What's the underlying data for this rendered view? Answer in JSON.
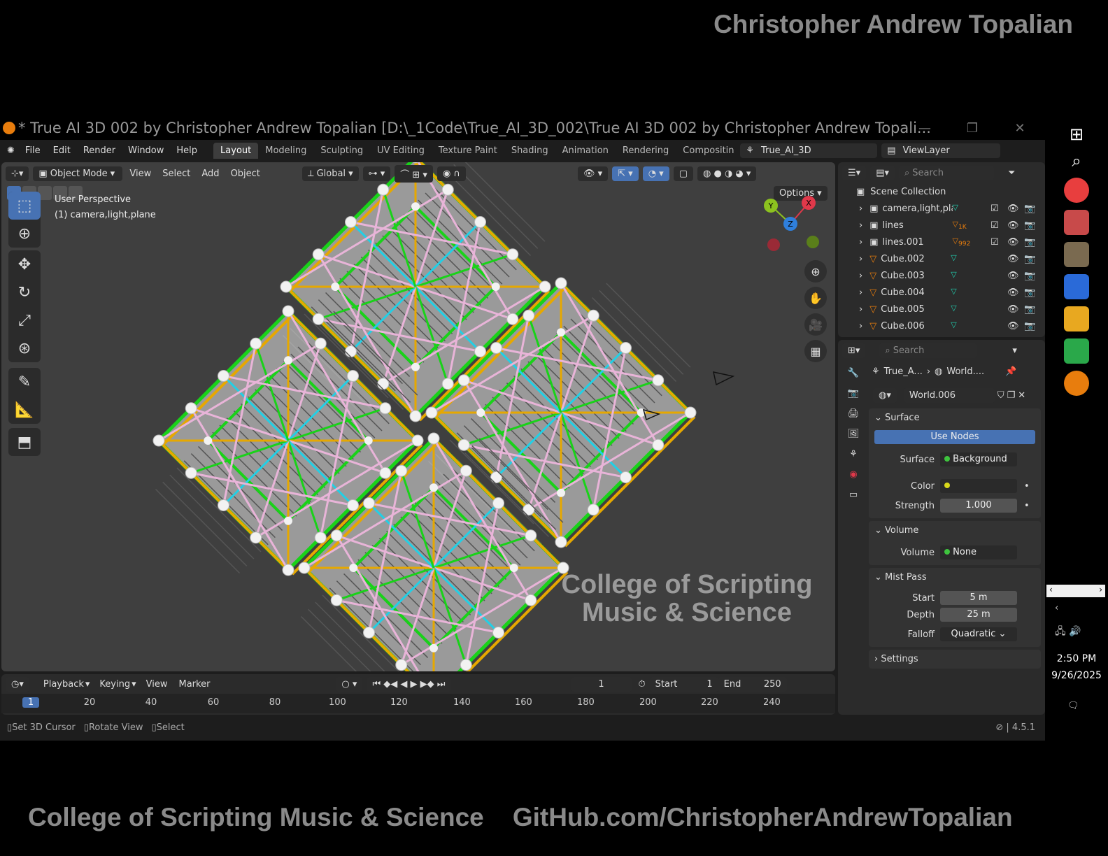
{
  "overlay": {
    "top_name": "Christopher Andrew Topalian",
    "bottom_left": "College of Scripting Music & Science",
    "bottom_right": "GitHub.com/ChristopherAndrewTopalian"
  },
  "window": {
    "title": "* True AI 3D 002 by Christopher Andrew Topalian [D:\\_1Code\\True_AI_3D_002\\True AI 3D 002 by Christopher Andrew Topali...",
    "minimize": "—",
    "restore": "❐",
    "close": "✕"
  },
  "menu": {
    "items": [
      "File",
      "Edit",
      "Render",
      "Window",
      "Help"
    ],
    "workspaces": [
      "Layout",
      "Modeling",
      "Sculpting",
      "UV Editing",
      "Texture Paint",
      "Shading",
      "Animation",
      "Rendering",
      "Compositin"
    ],
    "scene": "True_AI_3D",
    "view_layer": "ViewLayer"
  },
  "viewport": {
    "mode": "Object Mode",
    "menus": [
      "View",
      "Select",
      "Add",
      "Object"
    ],
    "orientation": "Global",
    "options": "Options",
    "persp": "User Perspective",
    "active": "(1) camera,light,plane",
    "watermark1": "College of Scripting",
    "watermark2": "Music & Science",
    "gizmo": {
      "x": "X",
      "y": "Y",
      "z": "Z"
    }
  },
  "timeline": {
    "menus": [
      "Playback",
      "Keying",
      "View",
      "Marker"
    ],
    "current_frame": "1",
    "start_label": "Start",
    "start": "1",
    "end_label": "End",
    "end": "250",
    "ruler": [
      "1",
      "20",
      "40",
      "60",
      "80",
      "100",
      "120",
      "140",
      "160",
      "180",
      "200",
      "220",
      "240"
    ]
  },
  "status": {
    "a": "Set 3D Cursor",
    "b": "Rotate View",
    "c": "Select",
    "version": "4.5.1"
  },
  "outliner": {
    "search": "Search",
    "root": "Scene Collection",
    "items": [
      {
        "name": "camera,light,plane",
        "sub": ""
      },
      {
        "name": "lines",
        "sub": "1K"
      },
      {
        "name": "lines.001",
        "sub": "992"
      },
      {
        "name": "Cube.002",
        "sub": ""
      },
      {
        "name": "Cube.003",
        "sub": ""
      },
      {
        "name": "Cube.004",
        "sub": ""
      },
      {
        "name": "Cube.005",
        "sub": ""
      },
      {
        "name": "Cube.006",
        "sub": ""
      }
    ]
  },
  "properties": {
    "search": "Search",
    "crumb1": "True_A...",
    "crumb2": "World....",
    "world": "World.006",
    "surface_header": "Surface",
    "use_nodes": "Use Nodes",
    "surface_label": "Surface",
    "surface_value": "Background",
    "color_label": "Color",
    "strength_label": "Strength",
    "strength": "1.000",
    "volume_header": "Volume",
    "volume_label": "Volume",
    "volume_value": "None",
    "mist_header": "Mist Pass",
    "start_label": "Start",
    "start": "5 m",
    "depth_label": "Depth",
    "depth": "25 m",
    "falloff_label": "Falloff",
    "falloff": "Quadratic",
    "settings_header": "Settings"
  },
  "taskbar": {
    "time": "2:50 PM",
    "date": "9/26/2025"
  },
  "colors": {
    "accent": "#4772b3",
    "blender_orange": "#e87d0d",
    "green": "#19d219",
    "orange": "#e6a800",
    "cyan": "#21d0e6",
    "pink": "#e8b4d8"
  }
}
